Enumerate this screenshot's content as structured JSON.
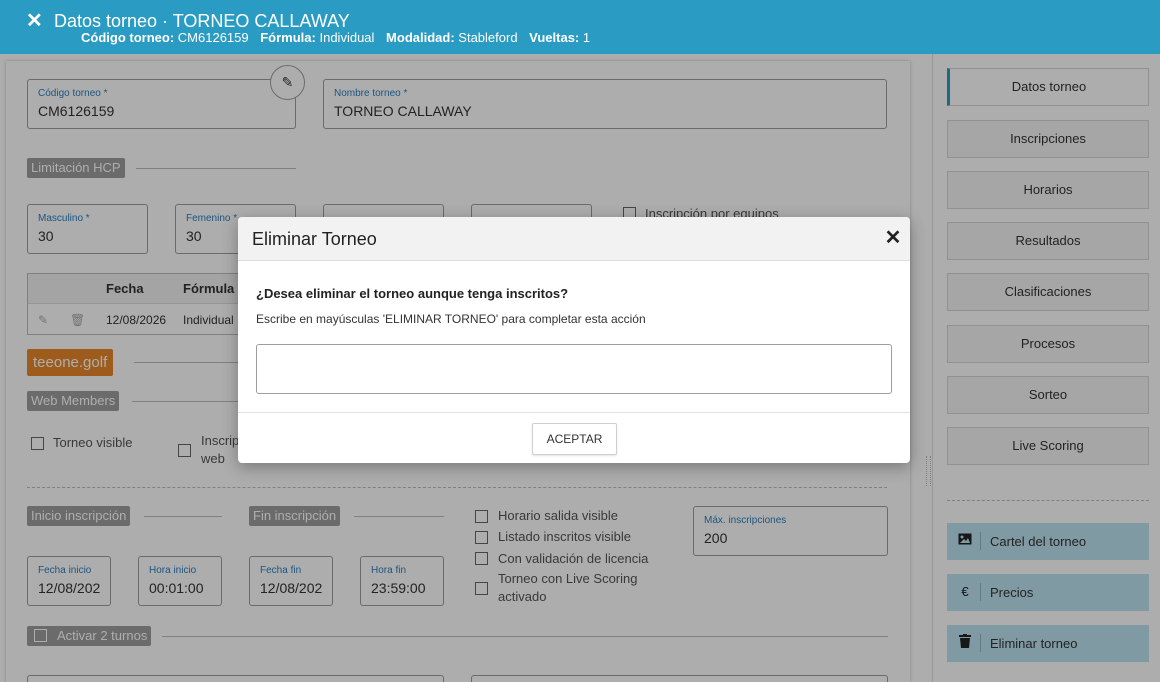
{
  "header": {
    "close_icon": "✕",
    "title": "Datos torneo · TORNEO CALLAWAY",
    "meta": {
      "codigo_label": "Código torneo:",
      "codigo_value": "CM6126159",
      "formula_label": "Fórmula:",
      "formula_value": "Individual",
      "modalidad_label": "Modalidad:",
      "modalidad_value": "Stableford",
      "vueltas_label": "Vueltas:",
      "vueltas_value": "1"
    }
  },
  "form": {
    "codigo": {
      "label": "Código torneo *",
      "value": "CM6126159"
    },
    "nombre": {
      "label": "Nombre torneo *",
      "value": "TORNEO CALLAWAY"
    },
    "edit_icon": "✎",
    "limitacion_hcp": "Limitación HCP",
    "masculino": {
      "label": "Masculino *",
      "value": "30"
    },
    "femenino": {
      "label": "Femenino *",
      "value": "30"
    },
    "inscripcion_equipos": "Inscripción por equipos",
    "table": {
      "headers": [
        "Fecha",
        "Fórmula"
      ],
      "row": {
        "fecha": "12/08/2026",
        "formula": "Individual"
      }
    },
    "brand": "teeone.golf",
    "web_members": "Web Members",
    "torneo_visible": "Torneo visible",
    "inscrip_web_1": "Inscrip",
    "inscrip_web_2": "web",
    "inicio_inscripcion": "Inicio inscripción",
    "fin_inscripcion": "Fin inscripción",
    "fecha_inicio": {
      "label": "Fecha inicio",
      "value": "12/08/202"
    },
    "hora_inicio": {
      "label": "Hora inicio",
      "value": "00:01:00"
    },
    "fecha_fin": {
      "label": "Fecha fin",
      "value": "12/08/202"
    },
    "hora_fin": {
      "label": "Hora fin",
      "value": "23:59:00"
    },
    "checks": {
      "horario_salida": "Horario salida visible",
      "listado_inscritos": "Listado inscritos visible",
      "validacion_licencia": "Con validación de licencia",
      "live_scoring_1": "Torneo con Live Scoring",
      "live_scoring_2": "activado"
    },
    "max_inscripciones": {
      "label": "Máx. inscripciones",
      "value": "200"
    },
    "activar_turnos": "Activar 2 turnos"
  },
  "sidebar": {
    "items": [
      {
        "label": "Datos torneo"
      },
      {
        "label": "Inscripciones"
      },
      {
        "label": "Horarios"
      },
      {
        "label": "Resultados"
      },
      {
        "label": "Clasificaciones"
      },
      {
        "label": "Procesos"
      },
      {
        "label": "Sorteo"
      },
      {
        "label": "Live Scoring"
      }
    ],
    "actions": [
      {
        "label": "Cartel del torneo",
        "icon": "image-icon"
      },
      {
        "label": "Precios",
        "icon": "euro-icon",
        "glyph": "€"
      },
      {
        "label": "Eliminar torneo",
        "icon": "trash-icon"
      }
    ]
  },
  "modal": {
    "title": "Eliminar Torneo",
    "close_icon": "✕",
    "question": "¿Desea eliminar el torneo aunque tenga inscritos?",
    "hint": "Escribe en mayúsculas 'ELIMINAR TORNEO' para completar esta acción",
    "input_value": "",
    "button": "ACEPTAR"
  },
  "colors": {
    "header": "#2a9cc4",
    "brand": "#e8862a",
    "action_bg": "#bde3f0",
    "label_blue": "#2a7fbf"
  }
}
